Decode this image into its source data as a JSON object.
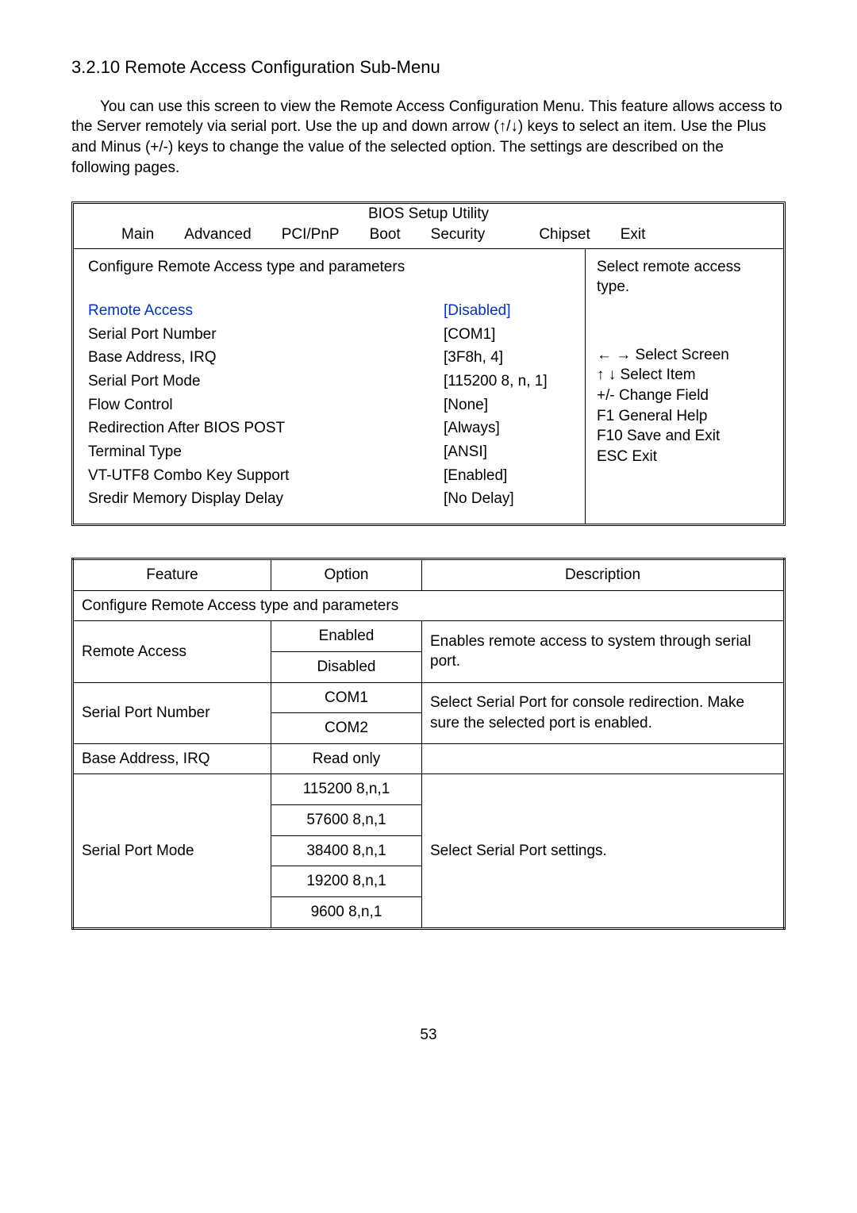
{
  "heading": "3.2.10 Remote Access Configuration Sub-Menu",
  "intro": "You can use this screen to view the Remote Access Configuration Menu. This feature allows access to the Server remotely via serial port. Use the up and down arrow (↑/↓) keys to select an item. Use the Plus and Minus (+/-) keys to change the value of the selected option. The settings are described on the following pages.",
  "bios": {
    "title": "BIOS Setup Utility",
    "menu": [
      "Main",
      "Advanced",
      "PCI/PnP",
      "Boot",
      "Security",
      "Chipset",
      "Exit"
    ],
    "cfg_title": "Configure Remote Access type and parameters",
    "settings": [
      {
        "label": "Remote Access",
        "value": "[Disabled]",
        "highlight": true
      },
      {
        "label": "Serial Port Number",
        "value": "[COM1]"
      },
      {
        "label": "Base Address, IRQ",
        "value": "[3F8h, 4]"
      },
      {
        "label": "Serial Port Mode",
        "value": "[115200  8, n, 1]"
      },
      {
        "label": "Flow Control",
        "value": "[None]"
      },
      {
        "label": "Redirection After BIOS POST",
        "value": "[Always]"
      },
      {
        "label": "Terminal Type",
        "value": "[ANSI]"
      },
      {
        "label": "VT-UTF8 Combo Key Support",
        "value": "[Enabled]"
      },
      {
        "label": "Sredir Memory Display Delay",
        "value": "[No Delay]"
      }
    ],
    "right_top": "Select remote access type.",
    "legend": [
      "← → Select Screen",
      "↑ ↓  Select Item",
      "+/-    Change Field",
      "F1     General Help",
      "F10   Save and Exit",
      "ESC  Exit"
    ]
  },
  "table": {
    "headers": [
      "Feature",
      "Option",
      "Description"
    ],
    "section_title": "Configure Remote Access type and parameters",
    "rows": [
      {
        "feature": "Remote Access",
        "options": [
          "Enabled",
          "Disabled"
        ],
        "description": "Enables remote access to system through serial port."
      },
      {
        "feature": "Serial Port Number",
        "options": [
          "COM1",
          "COM2"
        ],
        "description": "Select Serial Port for console redirection. Make sure the selected port is enabled."
      },
      {
        "feature": "Base Address, IRQ",
        "options": [
          "Read only"
        ],
        "description": ""
      },
      {
        "feature": "Serial Port Mode",
        "options": [
          "115200 8,n,1",
          "57600 8,n,1",
          "38400 8,n,1",
          "19200 8,n,1",
          "9600 8,n,1"
        ],
        "description": "Select Serial Port settings."
      }
    ]
  },
  "page_number": "53"
}
